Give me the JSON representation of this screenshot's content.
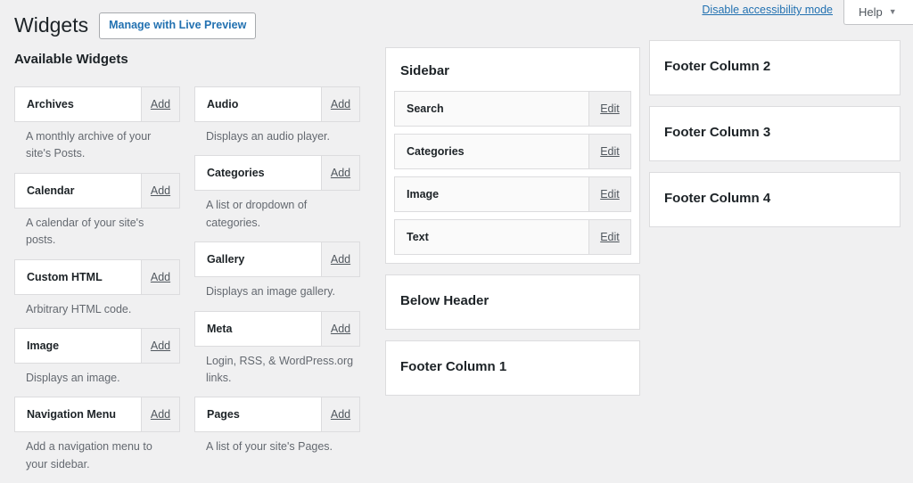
{
  "header": {
    "title": "Widgets",
    "live_preview_label": "Manage with Live Preview",
    "accessibility_link": "Disable accessibility mode",
    "help_label": "Help",
    "help_caret": "▼",
    "link_color": "#2271b1"
  },
  "available": {
    "heading": "Available Widgets",
    "add_label": "Add",
    "columns": [
      {
        "widgets": [
          {
            "name": "Archives",
            "description": "A monthly archive of your site's Posts."
          },
          {
            "name": "Calendar",
            "description": "A calendar of your site's posts."
          },
          {
            "name": "Custom HTML",
            "description": "Arbitrary HTML code."
          },
          {
            "name": "Image",
            "description": "Displays an image."
          },
          {
            "name": "Navigation Menu",
            "description": "Add a navigation menu to your sidebar."
          }
        ]
      },
      {
        "widgets": [
          {
            "name": "Audio",
            "description": "Displays an audio player."
          },
          {
            "name": "Categories",
            "description": "A list or dropdown of categories."
          },
          {
            "name": "Gallery",
            "description": "Displays an image gallery."
          },
          {
            "name": "Meta",
            "description": "Login, RSS, & WordPress.org links."
          },
          {
            "name": "Pages",
            "description": "A list of your site's Pages."
          }
        ]
      }
    ]
  },
  "sidebars": {
    "edit_label": "Edit",
    "middle_column": [
      {
        "title": "Sidebar",
        "widgets": [
          {
            "name": "Search"
          },
          {
            "name": "Categories"
          },
          {
            "name": "Image"
          },
          {
            "name": "Text"
          }
        ]
      },
      {
        "title": "Below Header",
        "widgets": []
      },
      {
        "title": "Footer Column 1",
        "widgets": []
      }
    ],
    "right_column": [
      {
        "title": "Footer Column 2",
        "widgets": []
      },
      {
        "title": "Footer Column 3",
        "widgets": []
      },
      {
        "title": "Footer Column 4",
        "widgets": []
      }
    ]
  }
}
